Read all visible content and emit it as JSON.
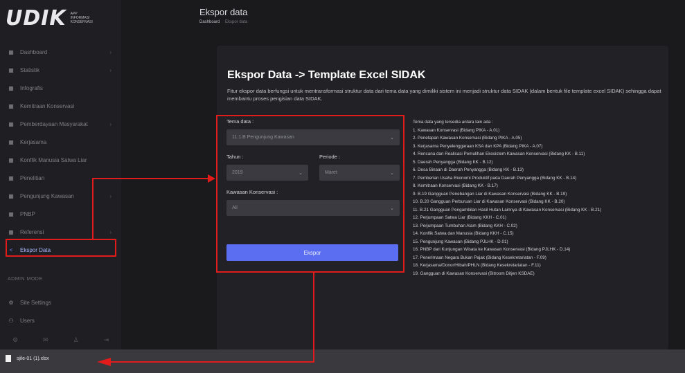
{
  "brand": {
    "logo": "UDIK",
    "sub": [
      "APP",
      "INFORMASI",
      "KONSERVASI"
    ]
  },
  "sidebar": {
    "items": [
      {
        "label": "Dashboard",
        "icon": "grid-icon",
        "chev": true
      },
      {
        "label": "Statistik",
        "icon": "grid-icon",
        "chev": true
      },
      {
        "label": "Infografis",
        "icon": "grid-icon",
        "chev": false
      },
      {
        "label": "Kemitraan Konservasi",
        "icon": "grid-icon",
        "chev": false
      },
      {
        "label": "Pemberdayaan Masyarakat",
        "icon": "grid-icon",
        "chev": true
      },
      {
        "label": "Kerjasama",
        "icon": "grid-icon",
        "chev": false
      },
      {
        "label": "Konflik Manusia Satwa Liar",
        "icon": "grid-icon",
        "chev": false
      },
      {
        "label": "Penelitian",
        "icon": "grid-icon",
        "chev": false
      },
      {
        "label": "Pengunjung Kawasan",
        "icon": "grid-icon",
        "chev": true
      },
      {
        "label": "PNBP",
        "icon": "grid-icon",
        "chev": false
      },
      {
        "label": "Referensi",
        "icon": "grid-icon",
        "chev": true
      },
      {
        "label": "Ekspor Data",
        "icon": "share-icon",
        "chev": false,
        "active": true
      }
    ],
    "section_title": "ADMIN MODE",
    "admin_items": [
      {
        "label": "Site Settings",
        "icon": "gear-icon"
      },
      {
        "label": "Users",
        "icon": "users-icon"
      }
    ]
  },
  "header": {
    "title": "Ekspor data",
    "breadcrumb_strong": "Dashboard",
    "breadcrumb": "Ekspor data"
  },
  "card": {
    "title": "Ekspor Data -> Template Excel SIDAK",
    "description": "Fitur ekspor data berfungsi untuk mentransformasi struktur data dari tema data yang dimiliki sistem ini menjadi struktur data SIDAK (dalam bentuk file template excel SIDAK) sehingga dapat membantu proses pengisian data SIDAK."
  },
  "form": {
    "tema_label": "Tema data :",
    "tema_value": "11.1.B Pengunjung Kawasan",
    "tahun_label": "Tahun :",
    "tahun_value": "2019",
    "periode_label": "Periode :",
    "periode_value": "Maret",
    "kawasan_label": "Kawasan Konservasi :",
    "kawasan_value": "All",
    "submit_label": "Ekspor"
  },
  "list": {
    "title": "Tema data yang tersedia antara lain ada :",
    "items": [
      "1. Kawasan Konservasi (Bidang PIKA - A.01)",
      "2. Penetapan Kawasan Konservasi (Bidang PIKA - A.05)",
      "3. Kerjasama Penyelenggaraan KSA dan KPA (Bidang PIKA - A.07)",
      "4. Rencana dan Realisasi Pemulihan Ekosistem Kawasan Konservasi (Bidang KK - B.11)",
      "5. Daerah Penyangga (Bidang KK - B.12)",
      "6. Desa Binaan di Daerah Penyangga (Bidang KK - B.13)",
      "7. Pemberian Usaha Ekonomi Produktif pada Daerah Penyangga (Bidang KK - B.14)",
      "8. Kemitraan Konservasi (Bidang KK - B.17)",
      "9. B.19 Gangguan Penebangan Liar di Kawasan Konservasi (Bidang KK - B.19)",
      "10. B.20 Gangguan Perburuan Liar di Kawasan Konservasi (Bidang KK - B.20)",
      "11. B.21 Gangguan Pengambilan Hasil Hutan Lainnya di Kawasan Konservasi (Bidang KK - B.21)",
      "12. Perjumpaan Satwa Liar (Bidang KKH - C.01)",
      "13. Perjumpaan Tumbuhan Alam (Bidang KKH - C.02)",
      "14. Konflik Satwa dan Manusia (Bidang KKH - C.15)",
      "15. Pengunjung Kawasan (Bidang PJLHK - D.01)",
      "16. PNBP dari Kunjungan Wisata ke Kawasan Konservasi (Bidang PJLHK - D.14)",
      "17. Penerimaan Negara Bukan Pajak (Bidang Kesekretariatan - F.09)",
      "18. Kerjasama/Donor/Hibah/PHLN (Bidang Kesekretariatan - F.11)",
      "19. Gangguan di Kawasan Konservasi (Bitroom Ditjen KSDAE)"
    ]
  },
  "download": {
    "filename": "sjile-01 (1).xlsx"
  },
  "colors": {
    "accent": "#5b6ef2",
    "annotation": "#e21b1b"
  }
}
